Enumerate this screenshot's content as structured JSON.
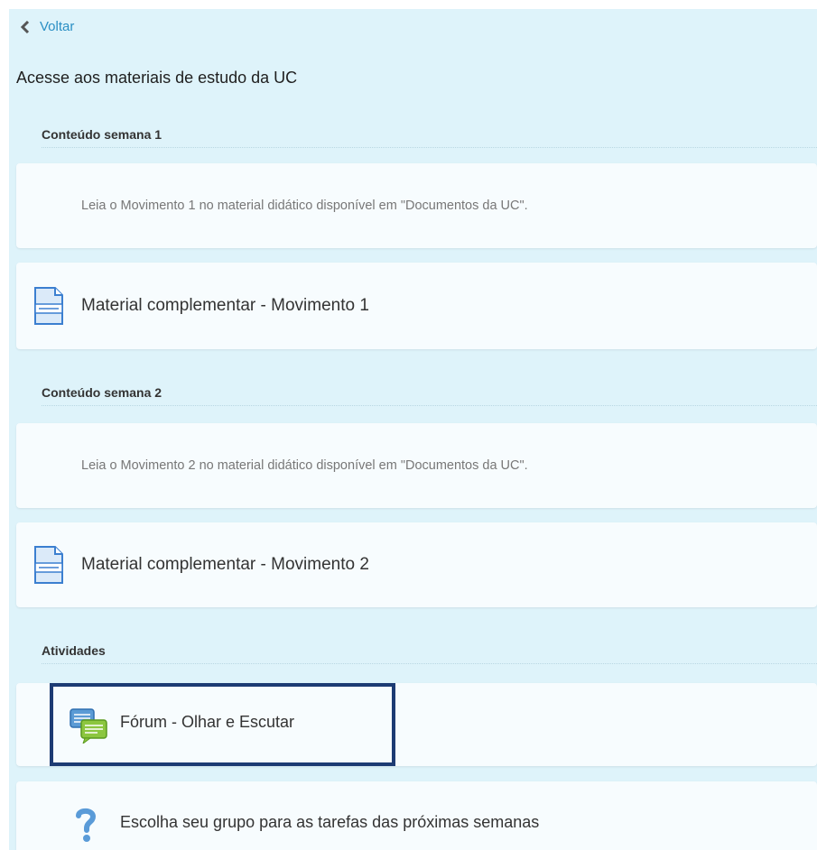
{
  "nav": {
    "back_label": "Voltar"
  },
  "page": {
    "title": "Acesse aos materiais de estudo da UC"
  },
  "sections": [
    {
      "title": "Conteúdo semana 1",
      "instruction": "Leia o Movimento 1 no material didático disponível em \"Documentos da UC\".",
      "resource_label": "Material complementar - Movimento 1",
      "resource_icon": "document-icon"
    },
    {
      "title": "Conteúdo semana 2",
      "instruction": "Leia o Movimento 2 no material didático disponível em \"Documentos da UC\".",
      "resource_label": "Material complementar - Movimento 2",
      "resource_icon": "document-icon"
    }
  ],
  "activities": {
    "title": "Atividades",
    "forum": {
      "label": "Fórum - Olhar e Escutar",
      "icon": "forum-icon"
    },
    "choice": {
      "label": "Escolha seu grupo para as tarefas das próximas semanas",
      "icon": "question-icon"
    }
  },
  "colors": {
    "background": "#def3fa",
    "card": "#f7fcfe",
    "link": "#2a8fc4",
    "highlight_border": "#1d3b73"
  }
}
